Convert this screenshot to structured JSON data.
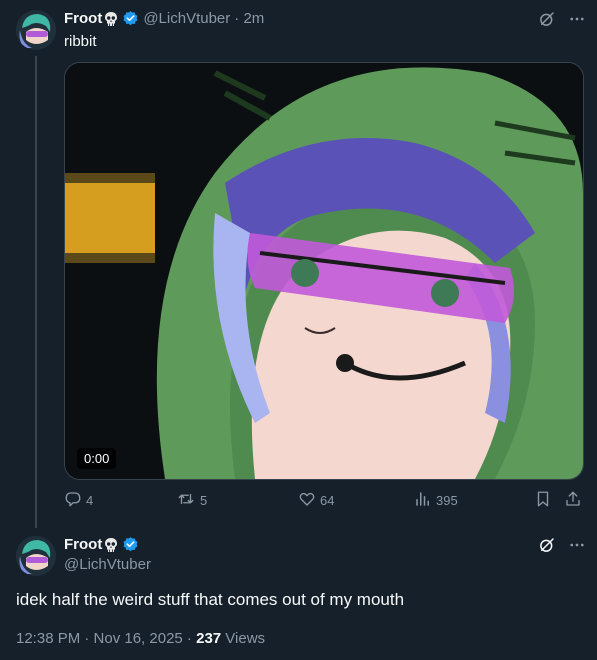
{
  "reply_context": {
    "author_name": "Froot",
    "author_handle": "@LichVtuber",
    "time_ago": "· 2m",
    "text": "ribbit",
    "video": {
      "duration": "0:00"
    },
    "actions": {
      "replies": "4",
      "reposts": "5",
      "likes": "64",
      "views": "395"
    }
  },
  "main_tweet": {
    "author_name": "Froot",
    "author_handle": "@LichVtuber",
    "text": "idek half the weird stuff that comes out of my mouth",
    "time": "12:38 PM · Nov 16, 2025 · ",
    "views_count": "237",
    "views_label": " Views"
  },
  "colors": {
    "background": "#15202b",
    "muted": "#8b98a5",
    "verified": "#1d9bf0",
    "divider": "#38444d"
  },
  "icons": [
    "skull-emoji",
    "verified-badge",
    "grok-icon",
    "more-icon",
    "reply-icon",
    "repost-icon",
    "like-icon",
    "views-icon",
    "bookmark-icon",
    "share-icon"
  ]
}
